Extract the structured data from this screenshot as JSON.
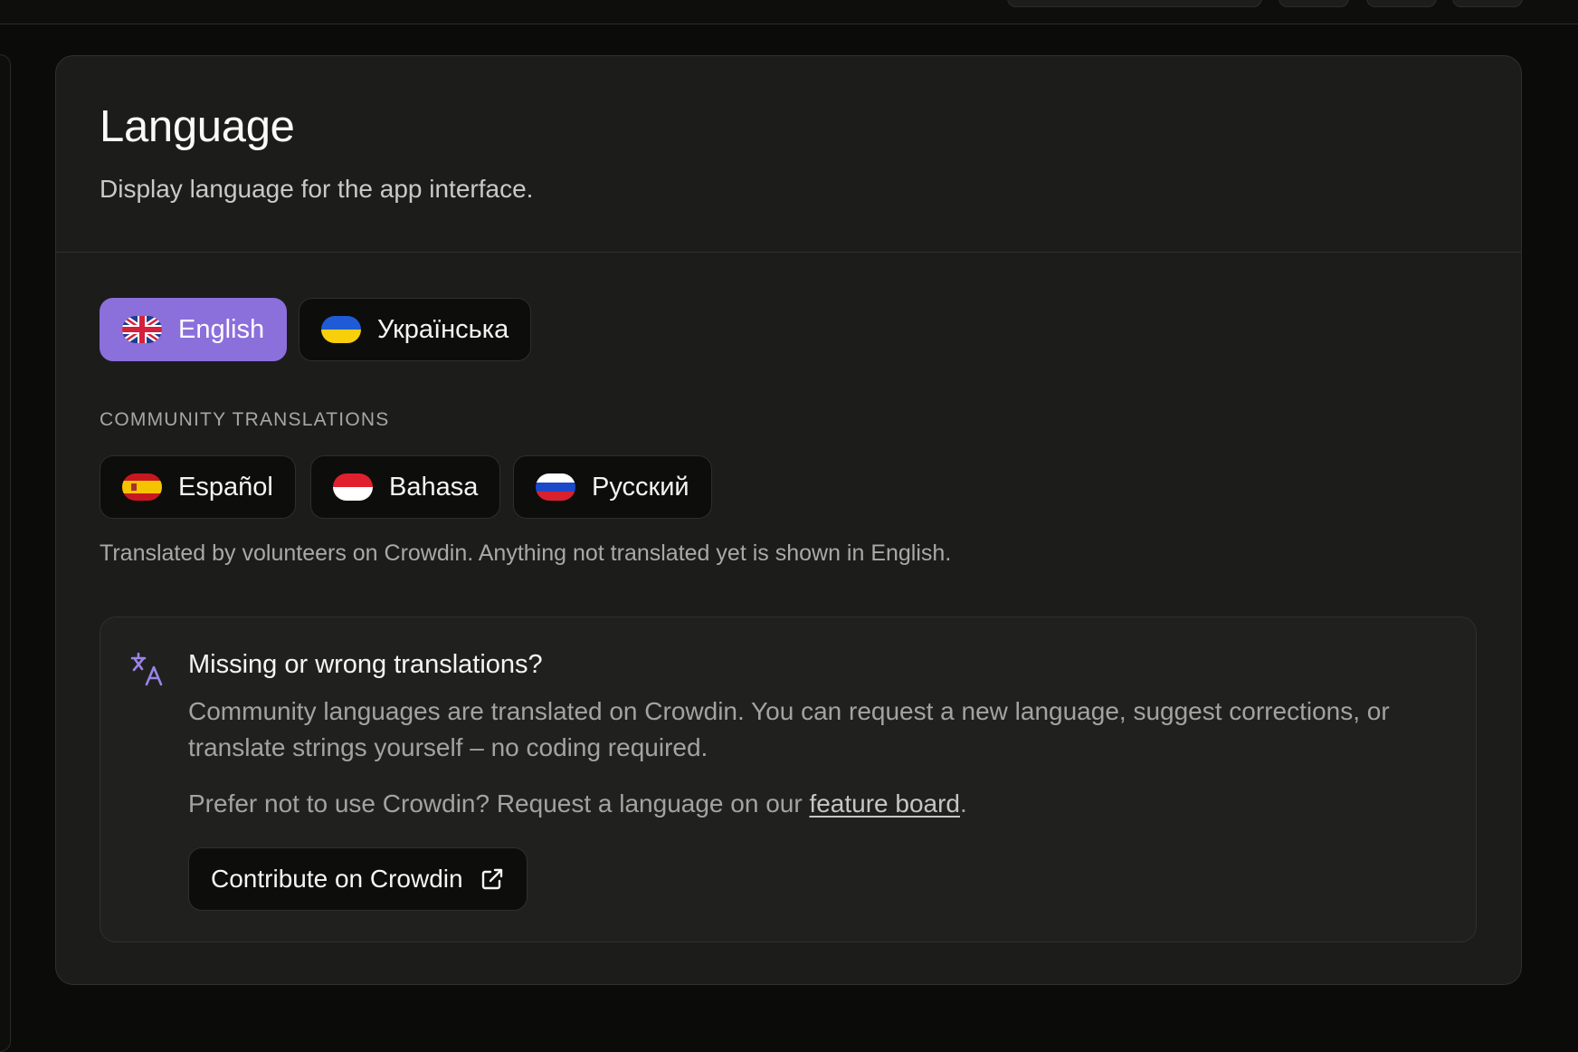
{
  "colors": {
    "accent": "#8b6fdb",
    "card": "#1c1c1b",
    "background": "#0b0b0a"
  },
  "section": {
    "title": "Language",
    "subtitle": "Display language for the app interface."
  },
  "languages": [
    {
      "label": "English",
      "flag": "uk-flag-icon",
      "selected": true
    },
    {
      "label": "Українська",
      "flag": "ukraine-flag-icon",
      "selected": false
    }
  ],
  "community": {
    "label": "COMMUNITY TRANSLATIONS",
    "languages": [
      {
        "label": "Español",
        "flag": "spain-flag-icon"
      },
      {
        "label": "Bahasa",
        "flag": "indonesia-flag-icon"
      },
      {
        "label": "Русский",
        "flag": "russia-flag-icon"
      }
    ],
    "helper": "Translated by volunteers on Crowdin. Anything not translated yet is shown in English."
  },
  "info": {
    "icon": "translate-icon",
    "title": "Missing or wrong translations?",
    "body": "Community languages are translated on Crowdin. You can request a new language, suggest corrections, or translate strings yourself – no coding required.",
    "prefer_prefix": "Prefer not to use Crowdin? Request a language on our ",
    "prefer_link": "feature board",
    "prefer_suffix": ".",
    "button_label": "Contribute on Crowdin",
    "button_icon": "external-link-icon"
  }
}
